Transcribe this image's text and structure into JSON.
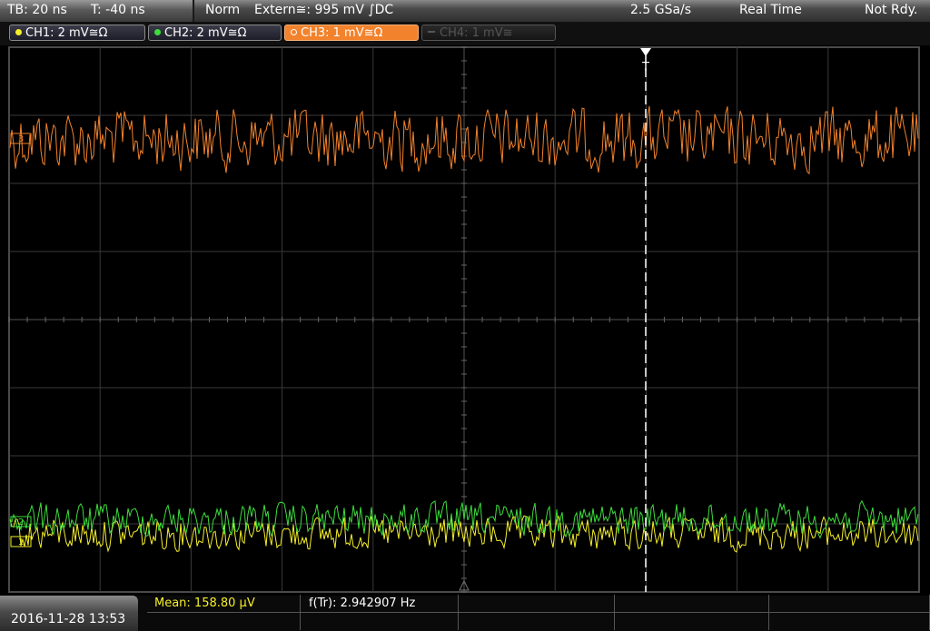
{
  "topbar": {
    "timebase": "TB: 20 ns",
    "trigger_time": "T: -40 ns",
    "trigger_mode": "Norm",
    "trigger_source": "Extern≅: 995 mV ∫DC",
    "sample_rate": "2.5 GSa/s",
    "acq_mode": "Real Time",
    "status": "Not Rdy."
  },
  "channels": [
    {
      "label": "CH1: 2 mV≅Ω",
      "color": "#f5ef2a",
      "state": "on"
    },
    {
      "label": "CH2: 2 mV≅Ω",
      "color": "#3ddc3d",
      "state": "on"
    },
    {
      "label": "CH3: 1 mV≅Ω",
      "color": "#f2822c",
      "state": "active"
    },
    {
      "label": "CH4: 1 mV≅",
      "color": "#555555",
      "state": "off"
    }
  ],
  "markers": {
    "trigger": "T",
    "ch3": "3",
    "ch2": "2",
    "ch1": "1"
  },
  "bottombar": {
    "datetime": "2016-11-28 13:53",
    "mean": "Mean: 158.80 µV",
    "frequency": "f(Tr): 2.942907 Hz"
  },
  "colors": {
    "ch1": "#f5ef2a",
    "ch2": "#3ddc3d",
    "ch3": "#f2822c",
    "grid": "#3a3a3a"
  }
}
